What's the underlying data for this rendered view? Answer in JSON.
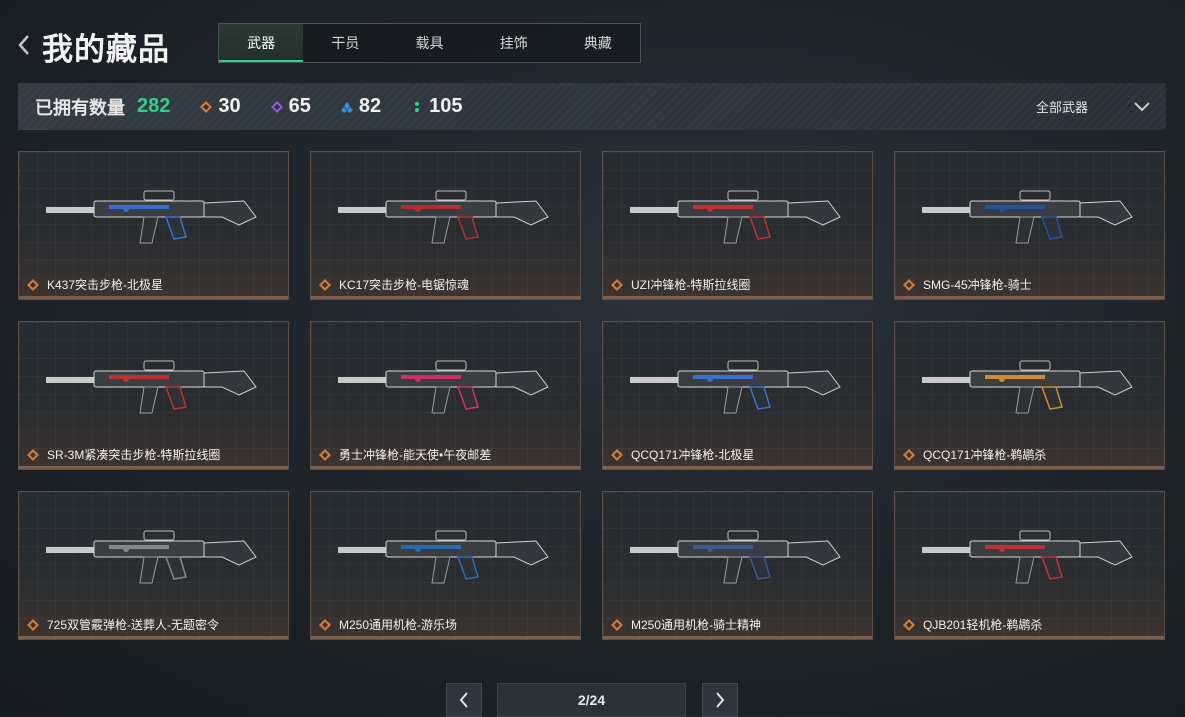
{
  "header": {
    "title": "我的藏品"
  },
  "tabs": [
    {
      "label": "武器",
      "active": true
    },
    {
      "label": "干员",
      "active": false
    },
    {
      "label": "载具",
      "active": false
    },
    {
      "label": "挂饰",
      "active": false
    },
    {
      "label": "典藏",
      "active": false
    }
  ],
  "stats": {
    "owned_label": "已拥有数量",
    "owned_count": "282",
    "rarities": [
      {
        "icon": "orange-diamond-icon",
        "color": "#d07a3a",
        "count": "30"
      },
      {
        "icon": "purple-diamond-icon",
        "color": "#8e5ad8",
        "count": "65"
      },
      {
        "icon": "blue-diamond-icon",
        "color": "#3c8ed8",
        "count": "82"
      },
      {
        "icon": "green-dots-icon",
        "color": "#2fd08a",
        "count": "105"
      }
    ],
    "filter_label": "全部武器"
  },
  "items": [
    {
      "name": "K437突击步枪-北极星",
      "accent": "#3a6fd0"
    },
    {
      "name": "KC17突击步枪-电锯惊魂",
      "accent": "#b03030"
    },
    {
      "name": "UZI冲锋枪-特斯拉线圈",
      "accent": "#c23030"
    },
    {
      "name": "SMG-45冲锋枪-骑士",
      "accent": "#2850a0"
    },
    {
      "name": "SR-3M紧凑突击步枪-特斯拉线圈",
      "accent": "#c23030"
    },
    {
      "name": "勇士冲锋枪-能天使•午夜邮差",
      "accent": "#d0306a"
    },
    {
      "name": "QCQ171冲锋枪-北极星",
      "accent": "#3a6fd0"
    },
    {
      "name": "QCQ171冲锋枪-鹈鹕杀",
      "accent": "#d08a30"
    },
    {
      "name": "725双管霰弹枪-送葬人-无题密令",
      "accent": "#888888"
    },
    {
      "name": "M250通用机枪-游乐场",
      "accent": "#2a6ab0"
    },
    {
      "name": "M250通用机枪-骑士精神",
      "accent": "#3a5a90"
    },
    {
      "name": "QJB201轻机枪-鹈鹕杀",
      "accent": "#c03030"
    }
  ],
  "pager": {
    "text": "2/24"
  }
}
